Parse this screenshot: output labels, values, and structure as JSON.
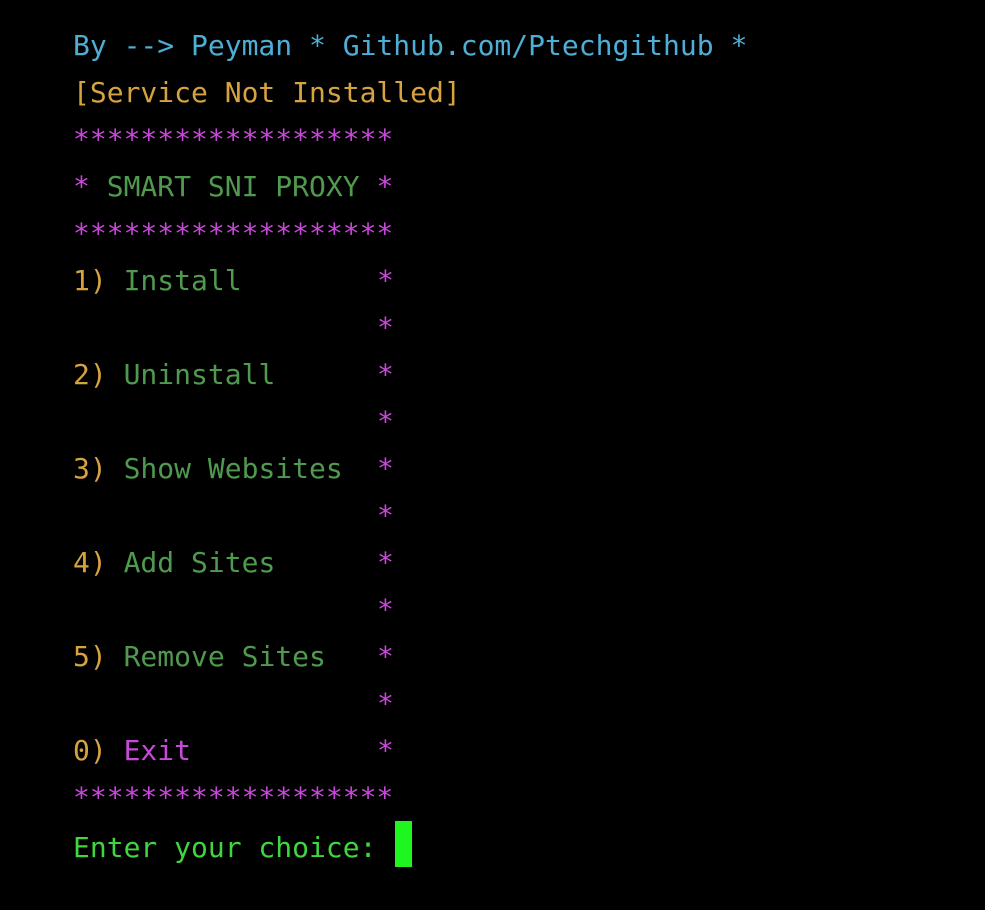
{
  "terminal": {
    "author_line": "By --> Peyman * Github.com/Ptechgithub *",
    "status_line": "[Service Not Installed]",
    "border": "*******************",
    "title_line": "* SMART SNI PROXY *",
    "star": "*",
    "menu": [
      {
        "number": "1)",
        "label": "Install"
      },
      {
        "number": "2)",
        "label": "Uninstall"
      },
      {
        "number": "3)",
        "label": "Show Websites"
      },
      {
        "number": "4)",
        "label": "Add Sites"
      },
      {
        "number": "5)",
        "label": "Remove Sites"
      },
      {
        "number": "0)",
        "label": "Exit"
      }
    ],
    "prompt": "Enter your choice: "
  },
  "colors": {
    "background": "#000000",
    "cyan": "#4eaed6",
    "orange": "#d7a33f",
    "magenta": "#c849d9",
    "green": "#4f9a4f",
    "prompt_green": "#3fd63f",
    "cursor": "#1ff51f"
  }
}
